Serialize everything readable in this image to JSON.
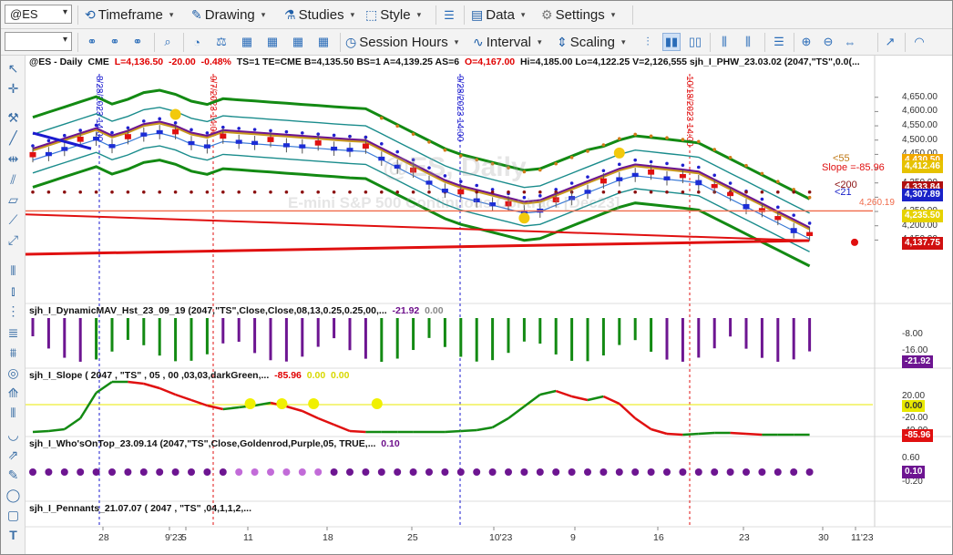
{
  "toolbar": {
    "symbol": "@ES",
    "timeframe": "Timeframe",
    "drawing": "Drawing",
    "studies": "Studies",
    "style": "Style",
    "data": "Data",
    "settings": "Settings",
    "session_hours": "Session Hours",
    "interval": "Interval",
    "scaling": "Scaling"
  },
  "chart": {
    "symbol_label": "@ES - Daily",
    "exchange": "CME",
    "last": "L=4,136.50",
    "change": "-20.00",
    "change_pct": "-0.48%",
    "info_rest": "TS=1  TE=CME  B=4,135.50  BS=1  A=4,139.25  AS=6",
    "open": "O=4,167.00",
    "hilo": "Hi=4,185.00  Lo=4,122.25  V=2,126,555  sjh_I_PHW_23.03.02 (2047,\"TS\",0.0(...",
    "watermark_symbol": "@ES, Daily",
    "watermark_desc": "E-mini S&P 500 Continuous Contract [Dec23]",
    "vline_labels": [
      "8/28/2023 14:00",
      "9/7/2023 14:00",
      "9/28/2023 14:00",
      "10/18/2023 14:00"
    ],
    "annotations": {
      "a55": "<55",
      "slope": "Slope =-85.96",
      "a200": "<200",
      "a21": "<21",
      "level_line": "4,260.19"
    },
    "price_ticks": [
      "4,650.00",
      "4,600.00",
      "4,550.00",
      "4,500.00",
      "4,450.00",
      "4,400.00",
      "4,350.00",
      "4,300.00",
      "4,250.00",
      "4,200.00",
      "4,150.00"
    ],
    "price_badges": [
      "4,430.50",
      "4,412.46",
      "4,333.84",
      "4,307.89",
      "4,235.50",
      "4,137.75"
    ],
    "x_ticks": [
      "28",
      "9'23",
      "5",
      "11",
      "18",
      "25",
      "10'23",
      "9",
      "16",
      "23",
      "30",
      "11'23"
    ]
  },
  "panels": {
    "p1": {
      "name": "sjh_I_DynamicMAV_Hst_23_09_19 (2047,\"TS\",Close,Close,08,13,0.25,0.25,00,...",
      "v1": "-21.92",
      "v2": "0.00",
      "ticks": [
        "-8.00",
        "-16.00"
      ],
      "badge": "-21.92"
    },
    "p2": {
      "name": "sjh_I_Slope ( 2047 , \"TS\" , 05 , 00 ,03,03,darkGreen,...",
      "v1": "-85.96",
      "v2": "0.00",
      "v3": "0.00",
      "ticks": [
        "20.00",
        "-20.00",
        "-40.00",
        "-60.00"
      ],
      "badge_zero": "0.00",
      "badge": "-85.96"
    },
    "p3": {
      "name": "sjh_I_Who'sOnTop_23.09.14 (2047,\"TS\",Close,Goldenrod,Purple,05,  TRUE,...",
      "v1": "0.10",
      "ticks": [
        "0.60",
        "0.20",
        "-0.20"
      ],
      "badge": "0.10"
    },
    "p4": {
      "name": "sjh_I_Pennants_21.07.07 (  2047 ,  \"TS\" ,04,1,1,2,..."
    }
  },
  "colors": {
    "up": "#1b2dd6",
    "down": "#e01010",
    "band_green": "#138a13",
    "gold": "#c8981e",
    "purple": "#6d1591",
    "teal": "#1a8c8c"
  }
}
